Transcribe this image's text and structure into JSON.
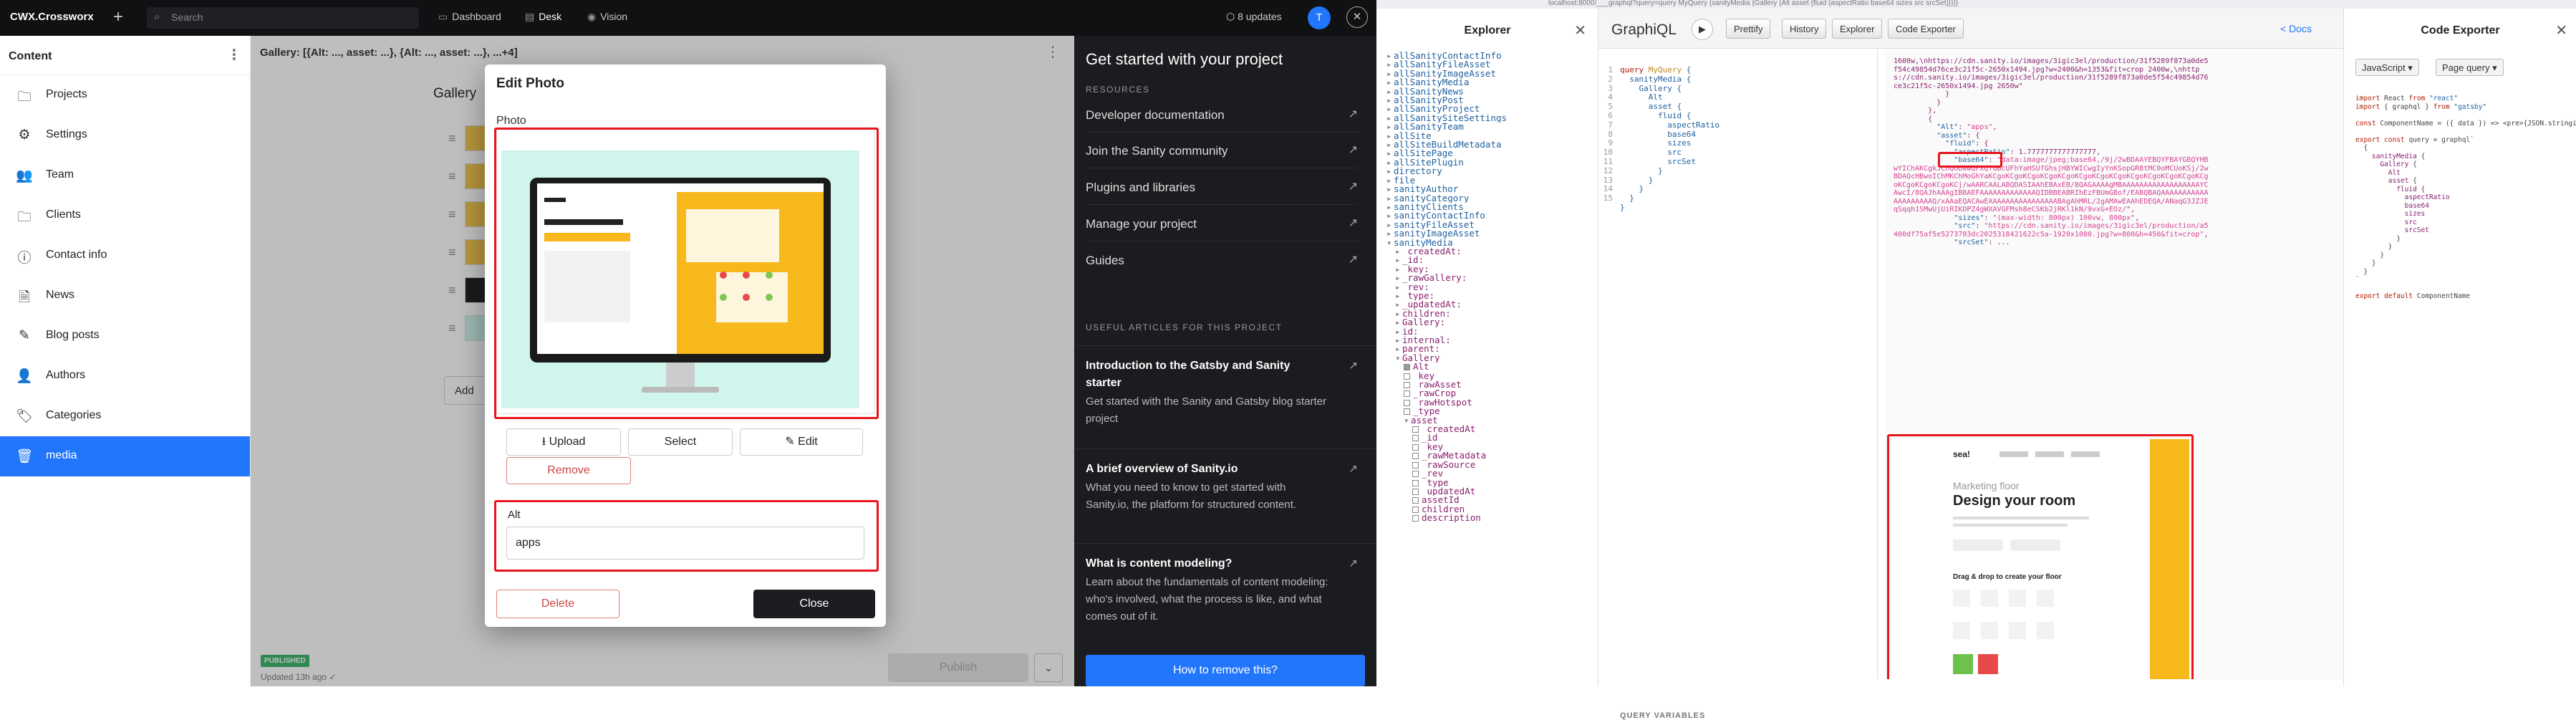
{
  "topbar": {
    "logo": "CWX.Crossworx",
    "plus": "+",
    "search_placeholder": "Search",
    "tabs": [
      {
        "label": "Dashboard",
        "icon": "dashboard-icon"
      },
      {
        "label": "Desk",
        "icon": "desk-icon"
      },
      {
        "label": "Vision",
        "icon": "eye-icon"
      }
    ],
    "updates": "8 updates",
    "avatar": "T"
  },
  "sidebar": {
    "title": "Content",
    "items": [
      {
        "label": "Projects",
        "icon": "folder-icon"
      },
      {
        "label": "Settings",
        "icon": "gear-icon"
      },
      {
        "label": "Team",
        "icon": "users-icon"
      },
      {
        "label": "Clients",
        "icon": "folder-icon"
      },
      {
        "label": "Contact info",
        "icon": "info-icon"
      },
      {
        "label": "News",
        "icon": "document-icon"
      },
      {
        "label": "Blog posts",
        "icon": "pencil-icon"
      },
      {
        "label": "Authors",
        "icon": "user-icon"
      },
      {
        "label": "Categories",
        "icon": "tag-icon"
      },
      {
        "label": "media",
        "icon": "trash-icon"
      }
    ]
  },
  "editor": {
    "doc_title": "Gallery: [{Alt: ..., asset: ...}, {Alt: ..., asset: ...}, ...+4]",
    "gallery_label": "Gallery",
    "add_label": "Add",
    "status_badge": "PUBLISHED",
    "status_time": "Updated 13h ago ✓",
    "publish_label": "Publish"
  },
  "dialog": {
    "title": "Edit Photo",
    "photo_label": "Photo",
    "upload": "Upload",
    "select": "Select",
    "edit": "Edit",
    "remove": "Remove",
    "alt_label": "Alt",
    "alt_value": "apps",
    "delete": "Delete",
    "close": "Close"
  },
  "sanity_panel": {
    "title": "Get started with your project",
    "resources_label": "RESOURCES",
    "resources": [
      "Developer documentation",
      "Join the Sanity community",
      "Plugins and libraries",
      "Manage your project",
      "Guides"
    ],
    "articles_label": "USEFUL ARTICLES FOR THIS PROJECT",
    "articles": [
      {
        "title": "Introduction to the Gatsby and Sanity starter",
        "desc": "Get started with the Sanity and Gatsby blog starter project"
      },
      {
        "title": "A brief overview of Sanity.io",
        "desc": "What you need to know to get started with Sanity.io, the platform for structured content."
      },
      {
        "title": "What is content modeling?",
        "desc": "Learn about the fundamentals of content modeling: who's involved, what the process is like, and what comes out of it."
      }
    ],
    "bottom_button": "How to remove this?"
  },
  "browser": {
    "url": "localhost:8000/___graphql?query=query MyQuery {sanityMedia {Gallery {Alt asset {fluid {aspectRatio base64 sizes src srcSet}}}}}"
  },
  "explorer": {
    "title": "Explorer",
    "items": [
      {
        "t": "allSanityContactInfo",
        "d": 0,
        "k": "arrow"
      },
      {
        "t": "allSanityFileAsset",
        "d": 0,
        "k": "arrow"
      },
      {
        "t": "allSanityImageAsset",
        "d": 0,
        "k": "arrow"
      },
      {
        "t": "allSanityMedia",
        "d": 0,
        "k": "arrow"
      },
      {
        "t": "allSanityNews",
        "d": 0,
        "k": "arrow"
      },
      {
        "t": "allSanityPost",
        "d": 0,
        "k": "arrow"
      },
      {
        "t": "allSanityProject",
        "d": 0,
        "k": "arrow"
      },
      {
        "t": "allSanitySiteSettings",
        "d": 0,
        "k": "arrow"
      },
      {
        "t": "allSanityTeam",
        "d": 0,
        "k": "arrow"
      },
      {
        "t": "allSite",
        "d": 0,
        "k": "arrow"
      },
      {
        "t": "allSiteBuildMetadata",
        "d": 0,
        "k": "arrow"
      },
      {
        "t": "allSitePage",
        "d": 0,
        "k": "arrow"
      },
      {
        "t": "allSitePlugin",
        "d": 0,
        "k": "arrow"
      },
      {
        "t": "directory",
        "d": 0,
        "k": "arrow"
      },
      {
        "t": "file",
        "d": 0,
        "k": "arrow"
      },
      {
        "t": "sanityAuthor",
        "d": 0,
        "k": "arrow"
      },
      {
        "t": "sanityCategory",
        "d": 0,
        "k": "arrow"
      },
      {
        "t": "sanityClients",
        "d": 0,
        "k": "arrow"
      },
      {
        "t": "sanityContactInfo",
        "d": 0,
        "k": "arrow"
      },
      {
        "t": "sanityFileAsset",
        "d": 0,
        "k": "arrow"
      },
      {
        "t": "sanityImageAsset",
        "d": 0,
        "k": "arrow"
      },
      {
        "t": "sanityMedia",
        "d": 0,
        "k": "open"
      },
      {
        "t": "_createdAt:",
        "d": 1,
        "k": "arrow"
      },
      {
        "t": "_id:",
        "d": 1,
        "k": "arrow"
      },
      {
        "t": "_key:",
        "d": 1,
        "k": "arrow"
      },
      {
        "t": "_rawGallery:",
        "d": 1,
        "k": "arrow"
      },
      {
        "t": "_rev:",
        "d": 1,
        "k": "arrow"
      },
      {
        "t": "_type:",
        "d": 1,
        "k": "arrow"
      },
      {
        "t": "_updatedAt:",
        "d": 1,
        "k": "arrow"
      },
      {
        "t": "children:",
        "d": 1,
        "k": "arrow"
      },
      {
        "t": "Gallery:",
        "d": 1,
        "k": "arrow"
      },
      {
        "t": "id:",
        "d": 1,
        "k": "arrow"
      },
      {
        "t": "internal:",
        "d": 1,
        "k": "arrow"
      },
      {
        "t": "parent:",
        "d": 1,
        "k": "arrow"
      },
      {
        "t": "Gallery",
        "d": 1,
        "k": "open"
      },
      {
        "t": "Alt",
        "d": 2,
        "k": "on"
      },
      {
        "t": "_key",
        "d": 2,
        "k": "off"
      },
      {
        "t": "_rawAsset",
        "d": 2,
        "k": "off"
      },
      {
        "t": "_rawCrop",
        "d": 2,
        "k": "off"
      },
      {
        "t": "_rawHotspot",
        "d": 2,
        "k": "off"
      },
      {
        "t": "_type",
        "d": 2,
        "k": "off"
      },
      {
        "t": "asset",
        "d": 2,
        "k": "open"
      },
      {
        "t": "_createdAt",
        "d": 3,
        "k": "off"
      },
      {
        "t": "_id",
        "d": 3,
        "k": "off"
      },
      {
        "t": "_key",
        "d": 3,
        "k": "off"
      },
      {
        "t": "_rawMetadata",
        "d": 3,
        "k": "off"
      },
      {
        "t": "_rawSource",
        "d": 3,
        "k": "off"
      },
      {
        "t": "_rev",
        "d": 3,
        "k": "off"
      },
      {
        "t": "_type",
        "d": 3,
        "k": "off"
      },
      {
        "t": "_updatedAt",
        "d": 3,
        "k": "off"
      },
      {
        "t": "assetId",
        "d": 3,
        "k": "off"
      },
      {
        "t": "children",
        "d": 3,
        "k": "off"
      },
      {
        "t": "description",
        "d": 3,
        "k": "off"
      }
    ]
  },
  "graphiql": {
    "title": "GraphiQL",
    "prettify": "Prettify",
    "history": "History",
    "explorer": "Explorer",
    "code_exporter": "Code Exporter",
    "docs": "< Docs",
    "line_numbers": "1\n2\n3\n4\n5\n6\n7\n8\n9\n10\n11\n12\n13\n14\n15",
    "query_vars": "QUERY VARIABLES"
  },
  "code_exporter": {
    "title": "Code Exporter",
    "lang": "JavaScript ▾",
    "mode": "Page query ▾"
  }
}
